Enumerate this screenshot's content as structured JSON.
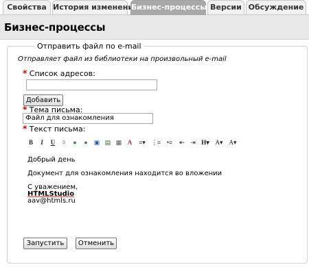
{
  "tabs": [
    {
      "label": "Свойства",
      "active": false
    },
    {
      "label": "История изменений",
      "active": false
    },
    {
      "label": "Бизнес-процессы",
      "active": true
    },
    {
      "label": "Версии",
      "active": false
    },
    {
      "label": "Обсуждение",
      "active": false
    }
  ],
  "page": {
    "title": "Бизнес-процессы"
  },
  "form": {
    "legend": "Отправить файл по e-mail",
    "description": "Отправляет файл из библиотеки на произвольный e-mail",
    "required_mark": "*",
    "addresses_label": "Список адресов:",
    "addresses_value": "",
    "add_button": "Добавить",
    "subject_label": "Тема письма:",
    "subject_value": "Файл для ознакомления",
    "text_label": "Текст письма:",
    "run_button": "Запустить",
    "cancel_button": "Отменить"
  },
  "editor": {
    "toolbar": [
      {
        "name": "bold-icon",
        "glyph": "B"
      },
      {
        "name": "italic-icon",
        "glyph": "I"
      },
      {
        "name": "underline-icon",
        "glyph": "U"
      },
      {
        "name": "eraser-icon",
        "glyph": "◊"
      },
      {
        "name": "link-icon",
        "glyph": "●"
      },
      {
        "name": "unlink-icon",
        "glyph": "●"
      },
      {
        "name": "image-icon",
        "glyph": "▣"
      },
      {
        "name": "video-icon",
        "glyph": "▤"
      },
      {
        "name": "table-icon",
        "glyph": "▦"
      },
      {
        "name": "font-color-icon",
        "glyph": "A"
      },
      {
        "name": "align-icon",
        "glyph": "≡▾"
      },
      {
        "name": "ordered-list-icon",
        "glyph": "⋮≡"
      },
      {
        "name": "unordered-list-icon",
        "glyph": "•≡"
      },
      {
        "name": "outdent-icon",
        "glyph": "⇤"
      },
      {
        "name": "indent-icon",
        "glyph": "⇥"
      },
      {
        "name": "heading-icon",
        "glyph": "H▾"
      },
      {
        "name": "font-size-icon",
        "glyph": "A▾"
      },
      {
        "name": "font-family-icon",
        "glyph": "A▾"
      }
    ],
    "lines": {
      "greeting": "Добрый день",
      "body": "Документ для ознакомления находится во вложении",
      "regards": "С уважением,",
      "company": "HTMLStudio",
      "email": "aav@htmls.ru"
    }
  },
  "colors": {
    "accent": "#c00",
    "active_tab": "#a8a8a8",
    "header_bg": "#e8e8e8"
  }
}
